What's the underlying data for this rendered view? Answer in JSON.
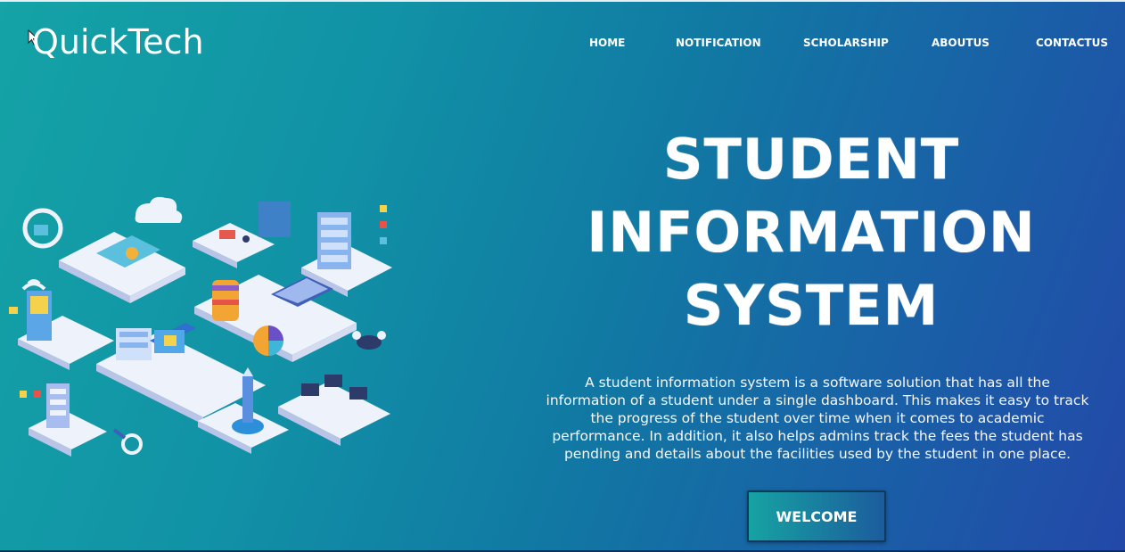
{
  "header": {
    "logo": "QuickTech"
  },
  "nav": {
    "items": [
      {
        "label": "HOME"
      },
      {
        "label": "NOTIFICATION"
      },
      {
        "label": "SCHOLARSHIP"
      },
      {
        "label": "ABOUTUS"
      },
      {
        "label": "CONTACTUS"
      }
    ]
  },
  "hero": {
    "title_lines": [
      "STUDENT",
      "INFORMATION",
      "SYSTEM"
    ],
    "description": "A student information system is a software solution that has all the information of a student under a single dashboard. This makes it easy to track the progress of the student over time when it comes to academic performance. In addition, it also helps admins track the fees the student has pending and details about the facilities used by the student in one place.",
    "button_label": "WELCOME"
  },
  "colors": {
    "gradient_start": "#14a3a6",
    "gradient_end": "#2348a8",
    "text": "#ffffff",
    "button_border": "#0f3a5f"
  },
  "icons": [
    "cursor-icon",
    "isometric-illustration"
  ]
}
